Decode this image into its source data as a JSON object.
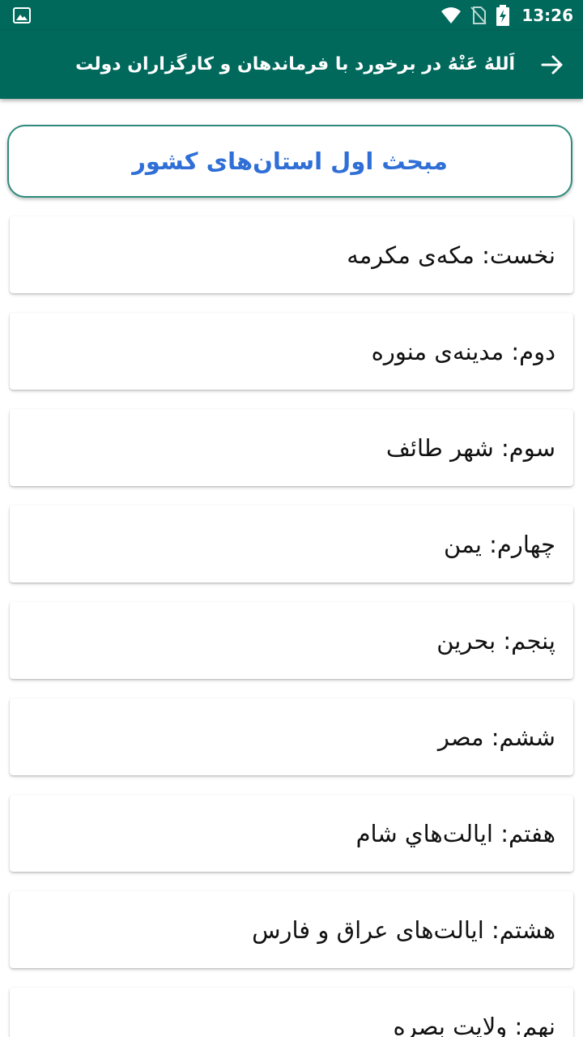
{
  "status_bar": {
    "time": "13:26",
    "icons": [
      "gallery-icon",
      "wifi-icon",
      "no-sim-icon",
      "battery-charging-icon"
    ]
  },
  "app_bar": {
    "title": "اَللهُ عَنْهُ در برخورد با فرماندهان و کارگزاران دولت",
    "back_icon": "arrow-right-icon"
  },
  "section": {
    "title": "مبحث اول استان‌های کشور"
  },
  "items": [
    {
      "label": "نخست: مکه‌ی مکرمه"
    },
    {
      "label": "دوم: مدینه‌ی منوره"
    },
    {
      "label": "سوم: شهر طائف"
    },
    {
      "label": "چهارم: یمن"
    },
    {
      "label": "پنجم: بحرین"
    },
    {
      "label": "ششم: مصر"
    },
    {
      "label": "هفتم: ايالت‌هاي شام"
    },
    {
      "label": "هشتم: ایالت‌های عراق و فارس"
    },
    {
      "label": "نهم: ولایت بصره"
    }
  ],
  "colors": {
    "primary": "#00695c",
    "section_title": "#2f6fd6",
    "section_border": "#2e8b7c"
  }
}
